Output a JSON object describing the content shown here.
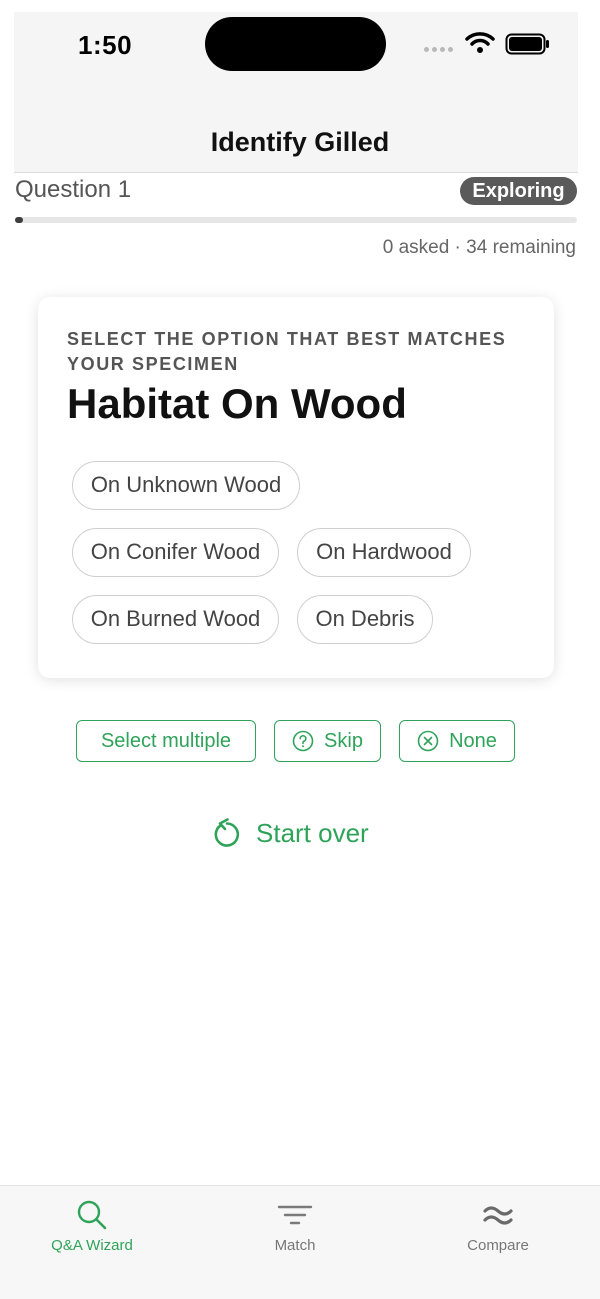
{
  "status_bar": {
    "time": "1:50"
  },
  "nav": {
    "title": "Identify Gilled"
  },
  "progress": {
    "question_label": "Question 1",
    "badge": "Exploring",
    "counts": "0 asked · 34 remaining",
    "fraction": 0.01
  },
  "question": {
    "instruction": "SELECT THE OPTION THAT BEST MATCHES YOUR SPECIMEN",
    "title": "Habitat On Wood",
    "options": [
      "On Unknown Wood",
      "On Conifer Wood",
      "On Hardwood",
      "On Burned Wood",
      "On Debris"
    ]
  },
  "actions": {
    "select_multiple": "Select multiple",
    "skip": "Skip",
    "none": "None",
    "start_over": "Start over"
  },
  "tabs": [
    {
      "label": "Q&A Wizard",
      "icon": "search-icon",
      "active": true
    },
    {
      "label": "Match",
      "icon": "filter-icon",
      "active": false
    },
    {
      "label": "Compare",
      "icon": "approx-icon",
      "active": false
    }
  ],
  "colors": {
    "accent": "#2fa35a",
    "badge_bg": "#5a5a5a"
  }
}
